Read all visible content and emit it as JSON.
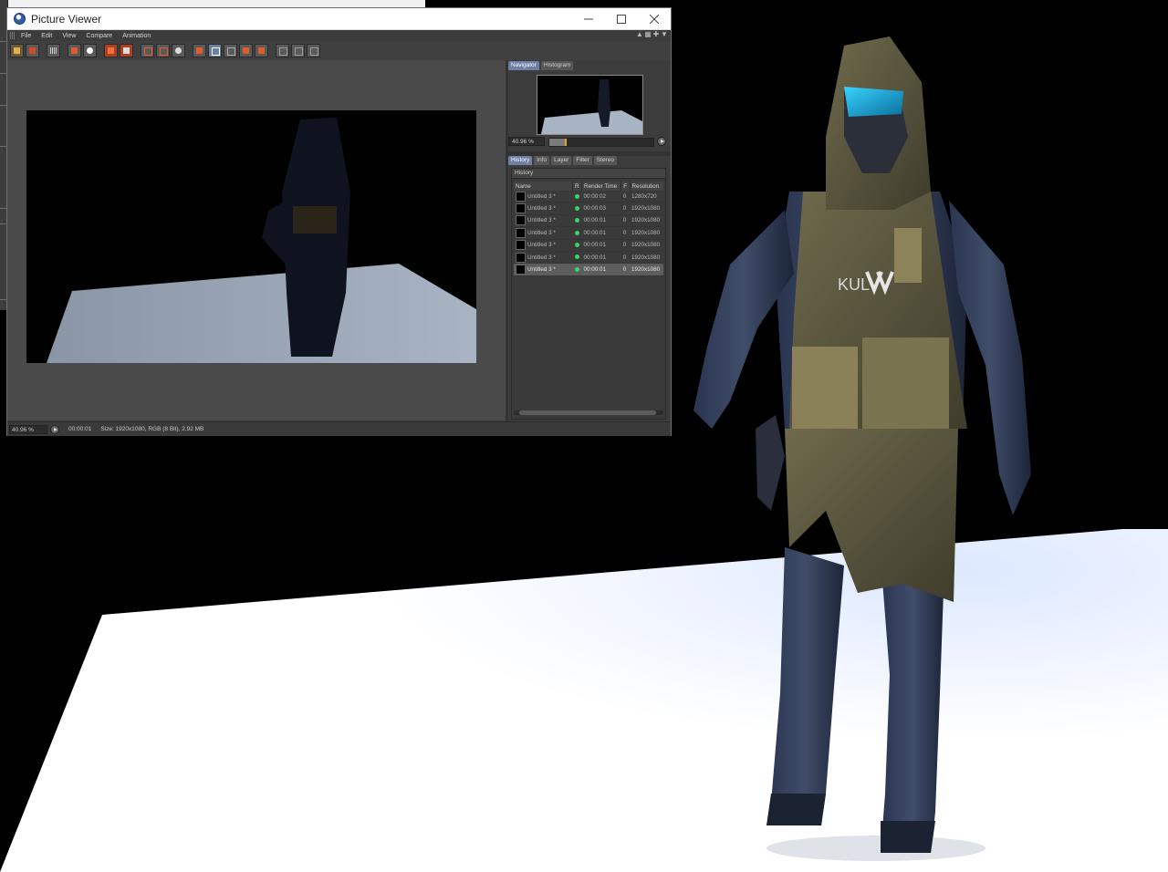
{
  "window": {
    "title": "Picture Viewer",
    "controls": [
      "minimize",
      "maximize",
      "close"
    ]
  },
  "menu": {
    "items": [
      "File",
      "Edit",
      "View",
      "Compare",
      "Animation"
    ]
  },
  "toolbar": {
    "icons": [
      "open-icon",
      "save-icon",
      "grid-icon",
      "copy-icon",
      "find-icon",
      "stop-icon",
      "render-icon",
      "frame-a-icon",
      "frame-b-icon",
      "settings-icon",
      "split-view-icon",
      "ab-compare-icon",
      "ab-swap-icon",
      "a-icon",
      "b-icon",
      "layer-a-icon",
      "layer-b-icon",
      "layer-c-icon"
    ]
  },
  "navigator": {
    "tabs": [
      "Navigator",
      "Histogram"
    ],
    "active_tab": "Navigator",
    "zoom": "40.96 %",
    "slider_fraction": 0.15
  },
  "history": {
    "tabs": [
      "History",
      "Info",
      "Layer",
      "Filter",
      "Stereo"
    ],
    "active_tab": "History",
    "heading": "History",
    "columns": [
      "Name",
      "R",
      "Render Time",
      "F",
      "Resolution"
    ],
    "rows": [
      {
        "name": "Untitled 3 *",
        "time": "00:00:02",
        "frame": "0",
        "res": "1280x720"
      },
      {
        "name": "Untitled 3 *",
        "time": "00:00:03",
        "frame": "0",
        "res": "1920x1080"
      },
      {
        "name": "Untitled 3 *",
        "time": "00:00:01",
        "frame": "0",
        "res": "1920x1080"
      },
      {
        "name": "Untitled 3 *",
        "time": "00:00:01",
        "frame": "0",
        "res": "1920x1080"
      },
      {
        "name": "Untitled 3 *",
        "time": "00:00:01",
        "frame": "0",
        "res": "1920x1080"
      },
      {
        "name": "Untitled 3 *",
        "time": "00:00:01",
        "frame": "0",
        "res": "1920x1080"
      },
      {
        "name": "Untitled 3 *",
        "time": "00:00:01",
        "frame": "0",
        "res": "1920x1080"
      }
    ],
    "selected_row": 6
  },
  "status": {
    "zoom": "40.96 %",
    "time": "00:00:01",
    "info": "Size: 1920x1080, RGB (8 Bit), 2.92 MB"
  },
  "colors": {
    "status_dot": "#3bd36a",
    "active_tab": "#6d7fa3",
    "slider_handle": "#e8a030"
  }
}
